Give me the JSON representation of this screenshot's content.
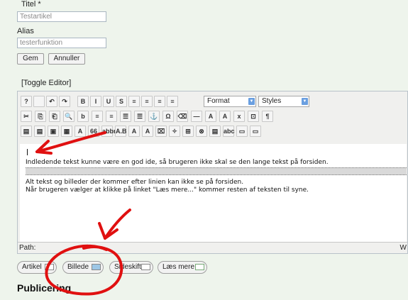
{
  "form": {
    "title_label": "Titel *",
    "title_value": "Testartikel",
    "alias_label": "Alias",
    "alias_value": "testerfunktion",
    "save_label": "Gem",
    "cancel_label": "Annuller",
    "toggle_editor": "[Toggle Editor]"
  },
  "toolbar": {
    "format_label": "Format",
    "styles_label": "Styles",
    "row1": [
      "help-icon",
      "new-document-icon",
      "undo-icon",
      "redo-icon",
      "bold-icon",
      "italic-icon",
      "underline-icon",
      "strikethrough-icon",
      "align-left-icon",
      "align-center-icon",
      "align-right-icon",
      "align-justify-icon"
    ],
    "row1_glyphs": [
      "?",
      "",
      "↶",
      "↷",
      "B",
      "I",
      "U",
      "S",
      "≡",
      "≡",
      "≡",
      "≡"
    ],
    "row2_glyphs": [
      "✂",
      "⎘",
      "⎗",
      "🔍",
      "b",
      "≡",
      "≡",
      "☰",
      "☰",
      "⚓",
      "Ω",
      "⌫",
      "—",
      "A",
      "A",
      "x",
      "⊡",
      "¶"
    ],
    "row3_glyphs": [
      "▤",
      "▤",
      "▣",
      "▦",
      "A",
      "66",
      "abbr",
      "A.B",
      "A",
      "A",
      "⌧",
      "✧",
      "⊞",
      "⊗",
      "▤",
      "abc",
      "▭",
      "▭"
    ]
  },
  "editor": {
    "paragraph1": "Indledende tekst kunne være en god ide, så brugeren ikke skal se den lange tekst på forsiden.",
    "paragraph2_line1": "Alt tekst og billeder der kommer efter linien kan ikke se på forsiden.",
    "paragraph2_line2": "Når brugeren vælger at klikke på linket \"Læs mere...\" kommer resten af teksten til syne.",
    "path_label": "Path:",
    "word_count_label": "W"
  },
  "buttons": {
    "artikel": "Artikel",
    "billede": "Billede",
    "sideskift": "Sideskift",
    "laes_mere": "Læs mere"
  },
  "section": {
    "publicering": "Publicering"
  },
  "colors": {
    "annotation_red": "#e01010",
    "background": "#eef4ec"
  }
}
